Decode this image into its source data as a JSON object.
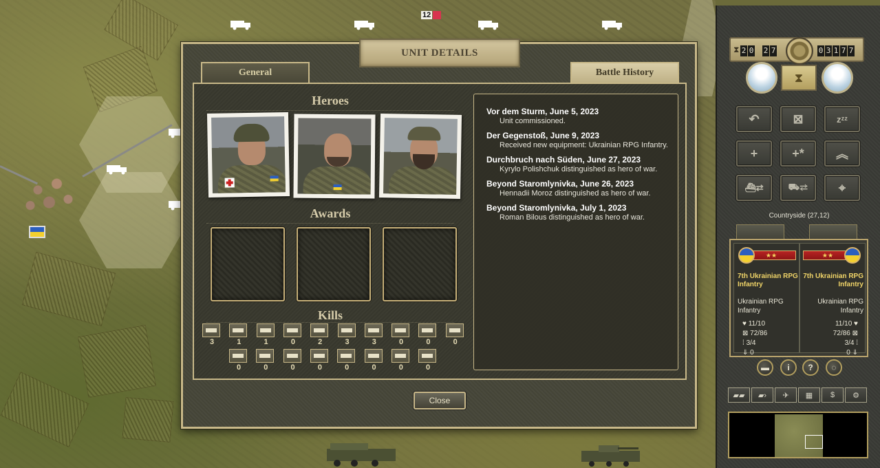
{
  "map": {
    "stack_count": "12",
    "colors": {
      "ukraine_blue": "#2c5fbf",
      "ukraine_yellow": "#f3d02f"
    }
  },
  "dialog": {
    "title": "UNIT DETAILS",
    "tabs": {
      "general": "General",
      "battle_history": "Battle History"
    },
    "heroes_heading": "Heroes",
    "awards_heading": "Awards",
    "kills_heading": "Kills",
    "kills_row1": [
      {
        "icon": "infantry-icon",
        "value": "3"
      },
      {
        "icon": "tank-icon",
        "value": "1"
      },
      {
        "icon": "recon-icon",
        "value": "1"
      },
      {
        "icon": "antitank-icon",
        "value": "0"
      },
      {
        "icon": "artillery-icon",
        "value": "2"
      },
      {
        "icon": "antiair-icon",
        "value": "3"
      },
      {
        "icon": "air-defense-icon",
        "value": "3"
      },
      {
        "icon": "fighter-icon",
        "value": "0"
      },
      {
        "icon": "tactical-bomber-icon",
        "value": "0"
      },
      {
        "icon": "strategic-bomber-icon",
        "value": "0"
      }
    ],
    "kills_row2": [
      {
        "icon": "submarine-icon",
        "value": "0"
      },
      {
        "icon": "destroyer-icon",
        "value": "0"
      },
      {
        "icon": "capital-ship-icon",
        "value": "0"
      },
      {
        "icon": "carrier-icon",
        "value": "0"
      },
      {
        "icon": "transport-icon",
        "value": "0"
      },
      {
        "icon": "helicopter-icon",
        "value": "0"
      },
      {
        "icon": "drone-icon",
        "value": "0"
      },
      {
        "icon": "fortification-icon",
        "value": "0"
      }
    ],
    "history": [
      {
        "title": "Vor dem Sturm, June 5, 2023",
        "text": "Unit commissioned."
      },
      {
        "title": "Der Gegenstoß, June 9, 2023",
        "text": "Received new equipment: Ukrainian RPG Infantry."
      },
      {
        "title": "Durchbruch nach Süden, June 27, 2023",
        "text": "Kyrylo Polishchuk distinguished as hero of war."
      },
      {
        "title": "Beyond Staromlynivka, June 26, 2023",
        "text": "Hennadii Moroz distinguished as hero of war."
      },
      {
        "title": "Beyond Staromlynivka, July 1, 2023",
        "text": "Roman Bilous distinguished as hero of war."
      }
    ],
    "close_label": "Close"
  },
  "sidebar": {
    "turn": [
      "2",
      "0"
    ],
    "max_turn": [
      "2",
      "7"
    ],
    "prestige": [
      "0",
      "3",
      "1",
      "7",
      "7"
    ],
    "hex_info": "Countryside (27,12)",
    "left_unit": {
      "rank_stars": "★★",
      "name": "7th Ukrainian RPG Infantry",
      "type": "Ukrainian RPG Infantry",
      "strength": "11/10",
      "ammo": "72/86",
      "fuel": "3/4",
      "experience": "0"
    },
    "right_unit": {
      "rank_stars": "★★",
      "name": "7th Ukrainian RPG Infantry",
      "type": "Ukrainian RPG Infantry",
      "strength": "11/10",
      "ammo": "72/86",
      "fuel": "3/4",
      "experience": "0"
    },
    "round_buttons": [
      "",
      "i",
      "?",
      ""
    ],
    "bottom_buttons": [
      "",
      "",
      "",
      "",
      "$",
      ""
    ]
  }
}
